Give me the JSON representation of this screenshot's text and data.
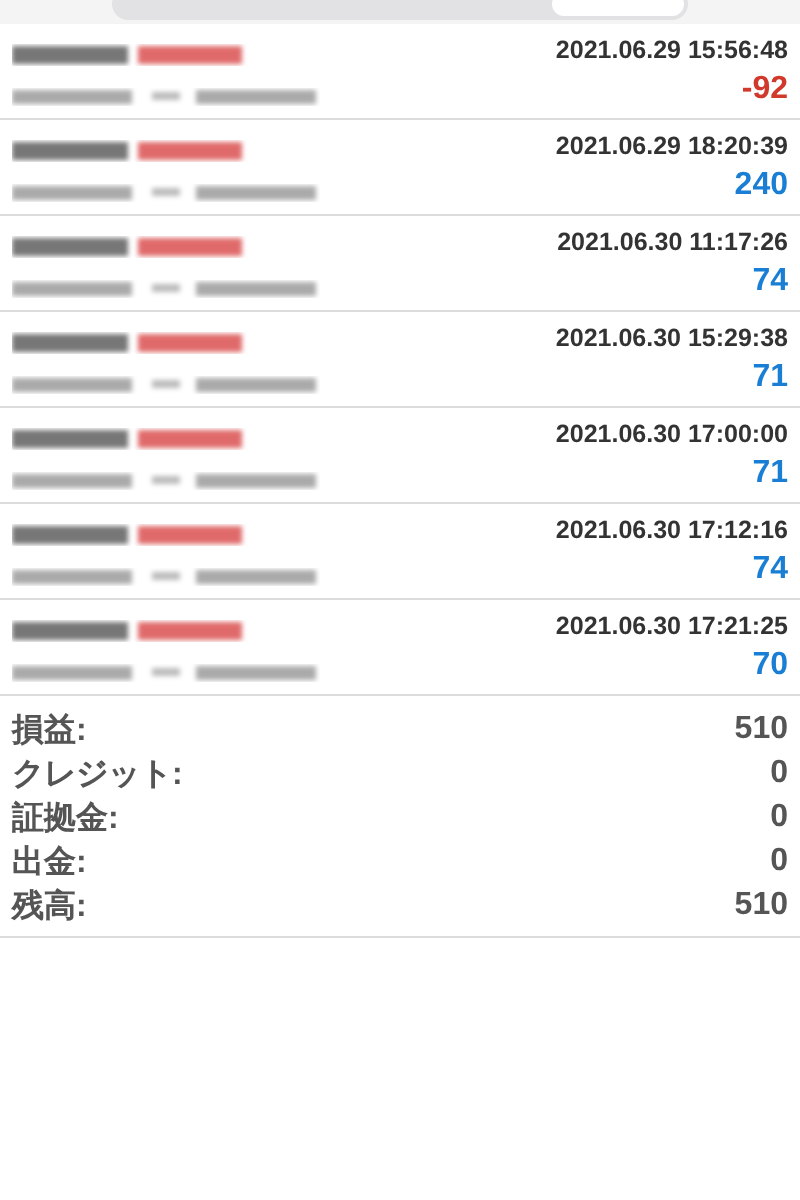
{
  "segmented_control": {
    "segments": [
      {
        "selected": false
      },
      {
        "selected": true
      }
    ]
  },
  "trades": [
    {
      "time": "2021.06.29 15:56:48",
      "profit": "-92",
      "color": "#d0392b"
    },
    {
      "time": "2021.06.29 18:20:39",
      "profit": "240",
      "color": "#1a7fd4"
    },
    {
      "time": "2021.06.30 11:17:26",
      "profit": "74",
      "color": "#1a7fd4"
    },
    {
      "time": "2021.06.30 15:29:38",
      "profit": "71",
      "color": "#1a7fd4"
    },
    {
      "time": "2021.06.30 17:00:00",
      "profit": "71",
      "color": "#1a7fd4"
    },
    {
      "time": "2021.06.30 17:12:16",
      "profit": "74",
      "color": "#1a7fd4"
    },
    {
      "time": "2021.06.30 17:21:25",
      "profit": "70",
      "color": "#1a7fd4"
    }
  ],
  "summary": [
    {
      "label": "損益:",
      "value": "510"
    },
    {
      "label": "クレジット:",
      "value": "0"
    },
    {
      "label": "証拠金:",
      "value": "0"
    },
    {
      "label": "出金:",
      "value": "0"
    },
    {
      "label": "残高:",
      "value": "510"
    }
  ]
}
